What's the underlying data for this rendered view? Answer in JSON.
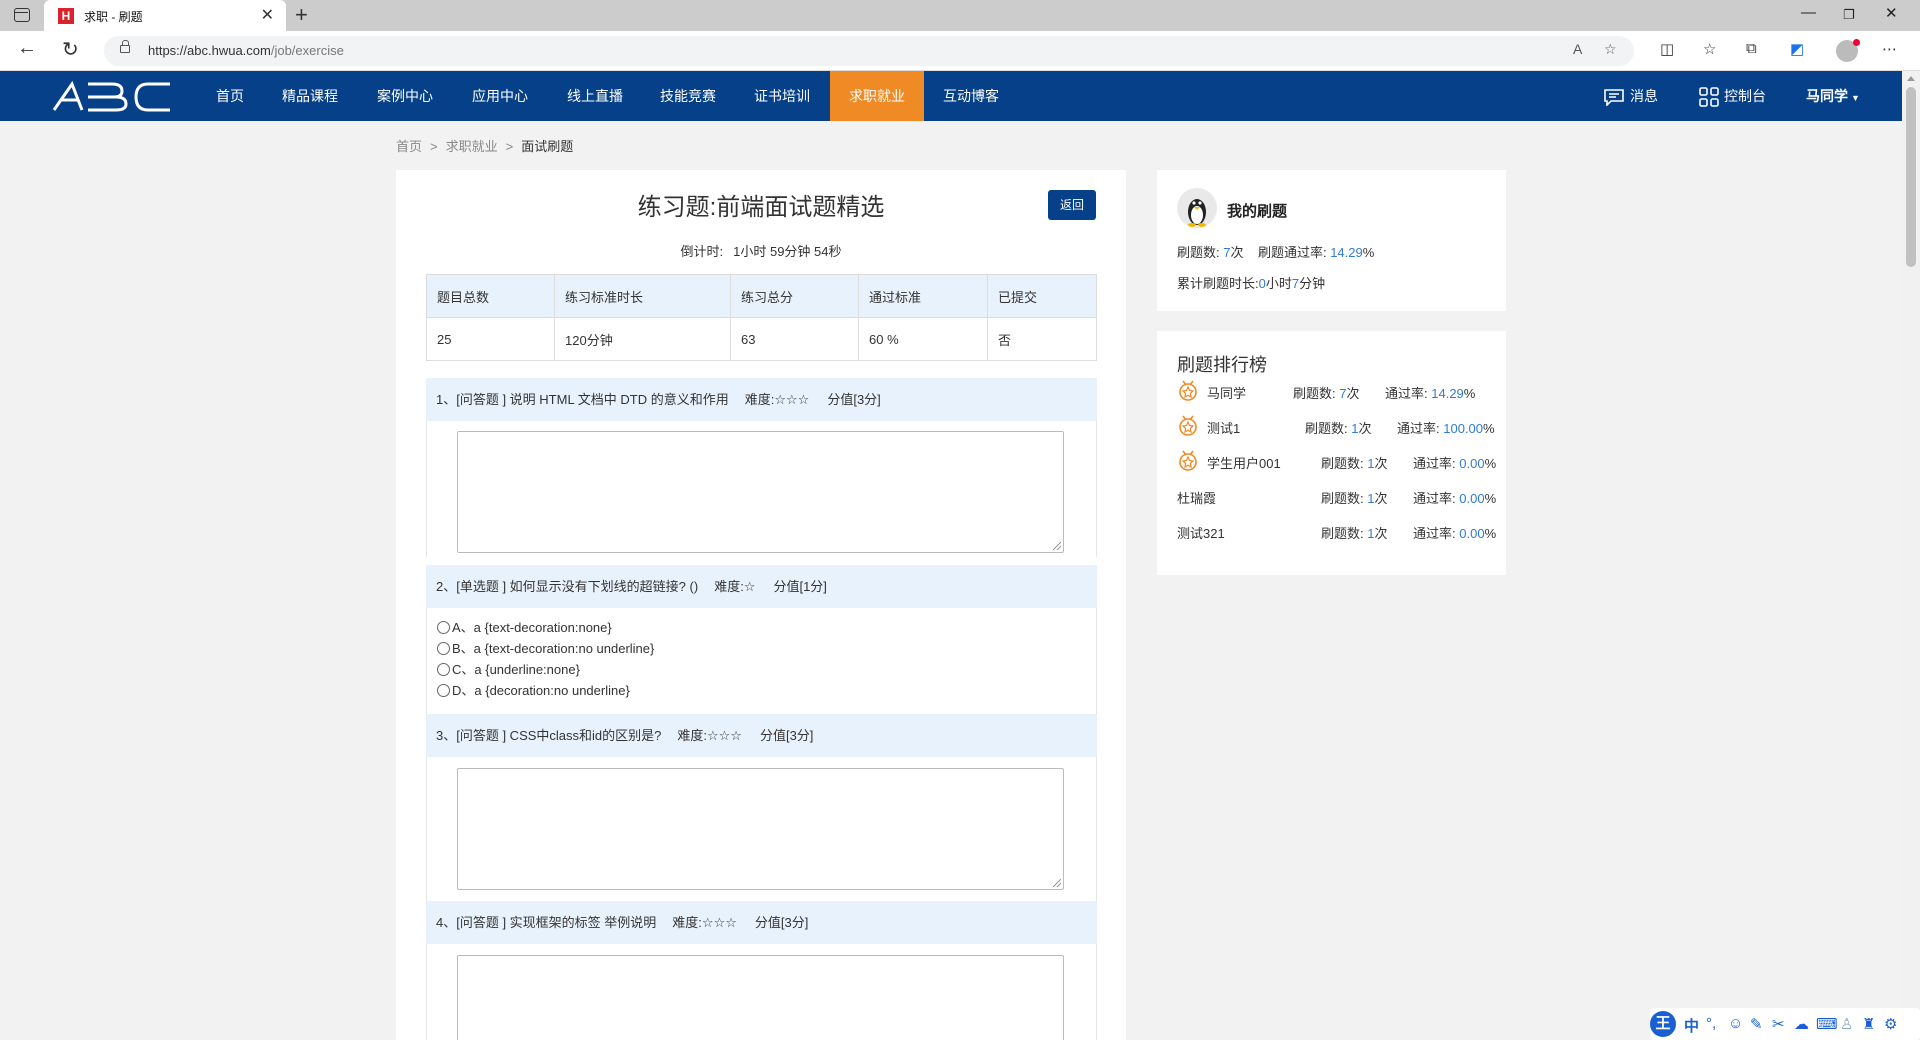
{
  "browser": {
    "tab_title": "求职 - 刷题",
    "favicon_letter": "H",
    "url_host": "https://abc.hwua.com",
    "url_path": "/job/exercise"
  },
  "nav": {
    "logo": "ABC",
    "items": [
      "首页",
      "精品课程",
      "案例中心",
      "应用中心",
      "线上直播",
      "技能竞赛",
      "证书培训",
      "求职就业",
      "互动博客"
    ],
    "active_index": 7,
    "messages": "消息",
    "console": "控制台",
    "user": "马同学"
  },
  "breadcrumb": [
    "首页",
    "求职就业",
    "面试刷题"
  ],
  "exercise": {
    "title": "练习题:前端面试题精选",
    "back": "返回",
    "countdown_label": "倒计时:",
    "countdown_value": "1小时 59分钟 54秒",
    "info_headers": [
      "题目总数",
      "练习标准时长",
      "练习总分",
      "通过标准",
      "已提交"
    ],
    "info_values": [
      "25",
      "120分钟",
      "63",
      "60 %",
      "否"
    ],
    "questions": [
      {
        "head": "1、[问答题 ] 说明 HTML 文档中 DTD 的意义和作用",
        "difficulty": "难度:☆☆☆",
        "score": "分值[3分]"
      },
      {
        "head": "2、[单选题 ] 如何显示没有下划线的超链接? ()",
        "difficulty": "难度:☆",
        "score": "分值[1分]",
        "options": [
          "A、a {text-decoration:none}",
          "B、a {text-decoration:no underline}",
          "C、a {underline:none}",
          "D、a {decoration:no underline}"
        ]
      },
      {
        "head": "3、[问答题 ] CSS中class和id的区别是?",
        "difficulty": "难度:☆☆☆",
        "score": "分值[3分]"
      },
      {
        "head": "4、[问答题 ] 实现框架的标签 举例说明",
        "difficulty": "难度:☆☆☆",
        "score": "分值[3分]"
      }
    ]
  },
  "my_practice": {
    "title": "我的刷题",
    "count_label": "刷题数:",
    "count_value": "7",
    "count_unit": "次",
    "rate_label": "刷题通过率:",
    "rate_value": "14.29",
    "rate_unit": "%",
    "duration_label": "累计刷题时长:",
    "hours": "0",
    "hours_unit": "小时",
    "minutes": "7",
    "minutes_unit": "分钟"
  },
  "ranking": {
    "title": "刷题排行榜",
    "count_label": "刷题数:",
    "count_unit": "次",
    "rate_label": "通过率:",
    "rate_unit": "%",
    "rows": [
      {
        "name": "马同学",
        "count": "7",
        "rate": "14.29"
      },
      {
        "name": "测试1",
        "count": "1",
        "rate": "100.00"
      },
      {
        "name": "学生用户001",
        "count": "1",
        "rate": "0.00"
      },
      {
        "name": "杜瑞霞",
        "count": "1",
        "rate": "0.00"
      },
      {
        "name": "测试321",
        "count": "1",
        "rate": "0.00"
      }
    ]
  },
  "ime": {
    "logo": "王",
    "mode": "中"
  },
  "colors": {
    "brand": "#064088",
    "active": "#ef8a24",
    "link": "#2f7bd8"
  }
}
